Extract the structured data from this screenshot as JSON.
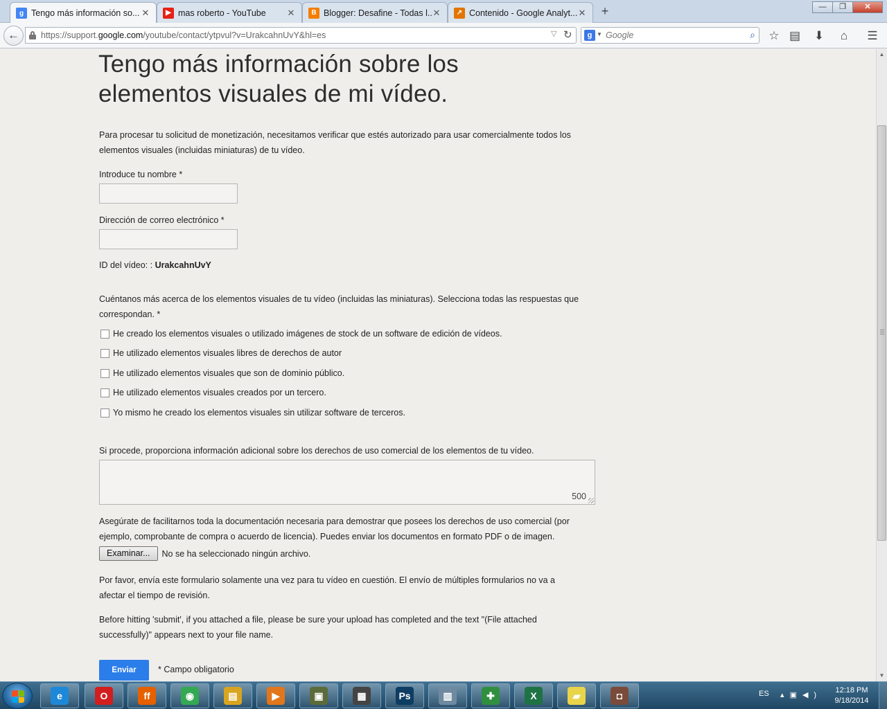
{
  "browser": {
    "tabs": [
      {
        "title": "Tengo más información so...",
        "icon": "google-support-icon",
        "color": "#4285f4",
        "active": true
      },
      {
        "title": "mas roberto - YouTube",
        "icon": "youtube-icon",
        "color": "#e62117",
        "active": false
      },
      {
        "title": "Blogger: Desafine - Todas l...",
        "icon": "blogger-icon",
        "color": "#f57d00",
        "active": false
      },
      {
        "title": "Contenido - Google Analyt...",
        "icon": "analytics-icon",
        "color": "#e37400",
        "active": false
      }
    ],
    "new_tab": "+",
    "window_buttons": {
      "minimize": "—",
      "restore": "❐",
      "close": "✕"
    },
    "url_prefix": "https://support.",
    "url_domain": "google.com",
    "url_rest": "/youtube/contact/ytpvul?v=UrakcahnUvY&hl=es",
    "search_placeholder": "Google"
  },
  "form": {
    "title": "Tengo más información sobre los elementos visuales de mi vídeo.",
    "intro": "Para procesar tu solicitud de monetización, necesitamos verificar que estés autorizado para usar comercialmente todos los elementos visuales (incluidas miniaturas) de tu vídeo.",
    "name_label": "Introduce tu nombre *",
    "email_label": "Dirección de correo electrónico *",
    "video_id_label": "ID del vídeo: : ",
    "video_id_value": "UrakcahnUvY",
    "visuals_question": "Cuéntanos más acerca de los elementos visuales de tu vídeo (incluidas las miniaturas). Selecciona todas las respuestas que correspondan. *",
    "options": [
      "He creado los elementos visuales o utilizado imágenes de stock de un software de edición de vídeos.",
      "He utilizado elementos visuales libres de derechos de autor",
      "He utilizado elementos visuales que son de dominio público.",
      "He utilizado elementos visuales creados por un tercero.",
      "Yo mismo he creado los elementos visuales sin utilizar software de terceros."
    ],
    "additional_label": "Si procede, proporciona información adicional sobre los derechos de uso comercial de los elementos de tu vídeo.",
    "char_counter": "500",
    "docs_text": "Asegúrate de facilitarnos toda la documentación necesaria para demostrar que posees los derechos de uso comercial (por ejemplo, comprobante de compra o acuerdo de licencia). Puedes enviar los documentos en formato PDF o de imagen.",
    "browse_label": "Examinar...",
    "no_file_text": "No se ha seleccionado ningún archivo.",
    "once_note": "Por favor, envía este formulario solamente una vez para tu vídeo en cuestión. El envío de múltiples formularios no va a afectar el tiempo de revisión.",
    "upload_note": "Before hitting 'submit', if you attached a file, please be sure your upload has completed and the text \"(File attached successfully)\" appears next to your file name.",
    "submit_label": "Enviar",
    "required_note": "* Campo obligatorio"
  },
  "taskbar": {
    "language": "ES",
    "time": "12:18 PM",
    "date": "9/18/2014",
    "apps": [
      {
        "name": "internet-explorer-icon",
        "glyph": "e",
        "color": "#1e88d8"
      },
      {
        "name": "opera-icon",
        "glyph": "O",
        "color": "#d21e1e"
      },
      {
        "name": "firefox-icon",
        "glyph": "ff",
        "color": "#e66000"
      },
      {
        "name": "chrome-icon",
        "glyph": "◉",
        "color": "#34a853"
      },
      {
        "name": "file-explorer-icon",
        "glyph": "▤",
        "color": "#d9a520"
      },
      {
        "name": "media-player-icon",
        "glyph": "▶",
        "color": "#e2761b"
      },
      {
        "name": "movie-maker-icon",
        "glyph": "▣",
        "color": "#5c6b3a"
      },
      {
        "name": "video-editor-icon",
        "glyph": "▦",
        "color": "#444444"
      },
      {
        "name": "photoshop-icon",
        "glyph": "Ps",
        "color": "#0e3d63"
      },
      {
        "name": "calculator-icon",
        "glyph": "▥",
        "color": "#6f8aa0"
      },
      {
        "name": "network-icon",
        "glyph": "✚",
        "color": "#2f8f3f"
      },
      {
        "name": "excel-icon",
        "glyph": "X",
        "color": "#1f7244"
      },
      {
        "name": "sticky-notes-icon",
        "glyph": "▰",
        "color": "#e9d44a"
      },
      {
        "name": "screenshot-icon",
        "glyph": "◘",
        "color": "#7a4b3a"
      }
    ]
  }
}
